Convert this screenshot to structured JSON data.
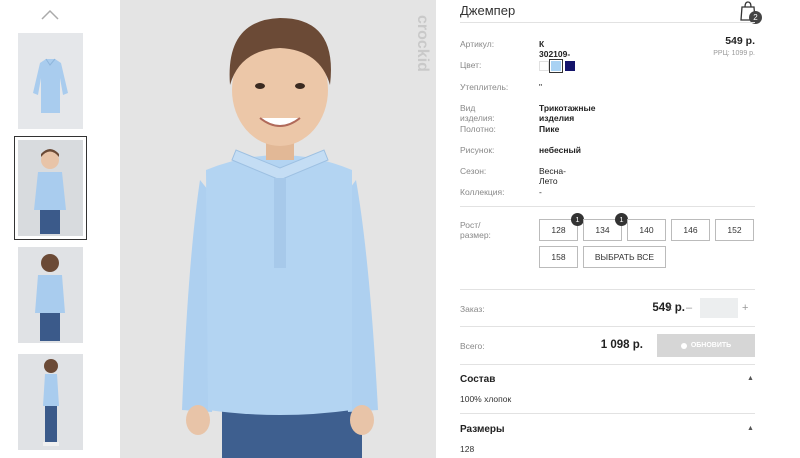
{
  "thumbnails": [
    {
      "name": "thumb-shirt"
    },
    {
      "name": "thumb-front"
    },
    {
      "name": "thumb-back"
    },
    {
      "name": "thumb-side"
    }
  ],
  "brand": "crockid",
  "product": {
    "title": "Джемпер",
    "cart_count": "2",
    "price": "549 р.",
    "rrc": "РРЦ: 1099 р."
  },
  "specs": [
    {
      "label": "Артикул:",
      "value": "К 302109-1"
    },
    {
      "label": "Цвет:",
      "value": ""
    },
    {
      "label": "Утеплитель:",
      "value": "\""
    },
    {
      "label": "Вид изделия:",
      "value": "Трикотажные изделия"
    },
    {
      "label": "Полотно:",
      "value": "Пике"
    },
    {
      "label": "Рисунок:",
      "value": "небесный"
    },
    {
      "label": "Сезон:",
      "value": "Весна-Лето"
    },
    {
      "label": "Коллекция:",
      "value": "-"
    }
  ],
  "colors": [
    "#ffffff",
    "#a9d2f3",
    "#14146b"
  ],
  "size_label": "Рост/размер:",
  "sizes": [
    {
      "label": "128",
      "qty": "1"
    },
    {
      "label": "134",
      "qty": "1"
    },
    {
      "label": "140",
      "qty": ""
    },
    {
      "label": "146",
      "qty": ""
    },
    {
      "label": "152",
      "qty": ""
    },
    {
      "label": "158",
      "qty": ""
    }
  ],
  "select_all": "ВЫБРАТЬ ВСЕ",
  "order": {
    "label": "Заказ:",
    "price": "549 р.",
    "times": "×",
    "minus": "–",
    "plus": "+",
    "qty": ""
  },
  "total": {
    "label": "Всего:",
    "price": "1 098 р.",
    "update": "ОБНОВИТЬ"
  },
  "composition": {
    "title": "Состав",
    "text": "100% хлопок"
  },
  "sizes_section": {
    "title": "Размеры",
    "text": "128"
  }
}
